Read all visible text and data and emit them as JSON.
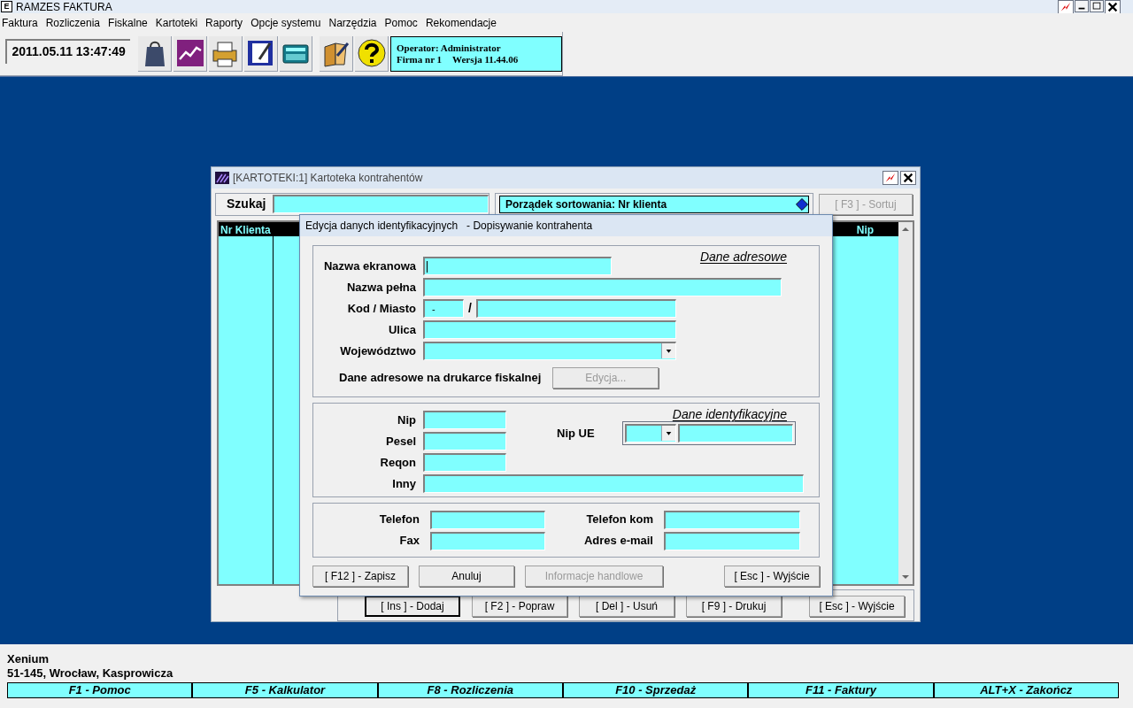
{
  "window": {
    "title": "RAMZES FAKTURA",
    "app_icon": "E"
  },
  "menu": [
    "Faktura",
    "Rozliczenia",
    "Fiskalne",
    "Kartoteki",
    "Raporty",
    "Opcje systemu",
    "Narzędzia",
    "Pomoc",
    "Rekomendacje"
  ],
  "toolbar": {
    "datetime": "2011.05.11 13:47:49",
    "operator": "Operator: Administrator",
    "firm": "Firma nr 1",
    "version": "Wersja 11.44.06"
  },
  "list_window": {
    "title": "[KARTOTEKI:1]  Kartoteka kontrahentów",
    "search_label": "Szukaj",
    "sort": "Porządek sortowania: Nr klienta",
    "sort_button": {
      "label": "[ F3 ] - Sortuj",
      "disabled": true
    },
    "columns": [
      "Nr Klienta",
      "Nip"
    ],
    "buttons": [
      {
        "label": "[ Ins ] - Dodaj",
        "selected": true
      },
      {
        "label": "[ F2 ] - Popraw",
        "selected": false
      },
      {
        "label": "[ Del ] - Usuń",
        "selected": false
      },
      {
        "label": "[ F9 ] - Drukuj",
        "selected": false
      },
      {
        "label": "[ Esc ] - Wyjście",
        "selected": false
      }
    ]
  },
  "dialog": {
    "title": "Edycja danych identyfikacyjnych   - Dopisywanie kontrahenta",
    "address": {
      "legend": "Dane adresowe",
      "fields": [
        {
          "label": "Nazwa ekranowa",
          "kind": "short",
          "focused": true
        },
        {
          "label": "Nazwa pełna",
          "kind": "full"
        },
        {
          "label": "Kod / Miasto",
          "kind": "city",
          "value": "-",
          "separator": "/"
        },
        {
          "label": "Ulica",
          "kind": "medium"
        },
        {
          "label": "Województwo",
          "kind": "select"
        }
      ],
      "fiscal_label": "Dane adresowe na drukarce fiskalnej",
      "fiscal_button": {
        "label": "Edycja...",
        "disabled": true
      }
    },
    "identification": {
      "legend": "Dane identyfikacyjne",
      "fields": [
        {
          "label": "Nip",
          "kind": "small"
        },
        {
          "label": "Pesel",
          "kind": "small"
        },
        {
          "label": "Reqon",
          "kind": "small"
        },
        {
          "label": "Inny",
          "kind": "wide"
        }
      ],
      "eu_label": "Nip UE"
    },
    "contact": {
      "fields": [
        {
          "label": "Telefon"
        },
        {
          "label": "Fax"
        },
        {
          "label": "Telefon kom"
        },
        {
          "label": "Adres e-mail"
        }
      ]
    },
    "buttons": [
      {
        "label": "[ F12 ] - Zapisz",
        "disabled": false
      },
      {
        "label": "Anuluj",
        "disabled": false
      },
      {
        "label": "Informacje handlowe",
        "disabled": true
      },
      {
        "label": "[ Esc ] - Wyjście",
        "disabled": false
      }
    ]
  },
  "status": {
    "company": "Xenium",
    "address": "51-145, Wrocław, Kasprowicza"
  },
  "function_keys": [
    "F1 - Pomoc",
    "F5 - Kalkulator",
    "F8 - Rozliczenia",
    "F10 - Sprzedaż",
    "F11 - Faktury",
    "ALT+X - Zakończ"
  ]
}
